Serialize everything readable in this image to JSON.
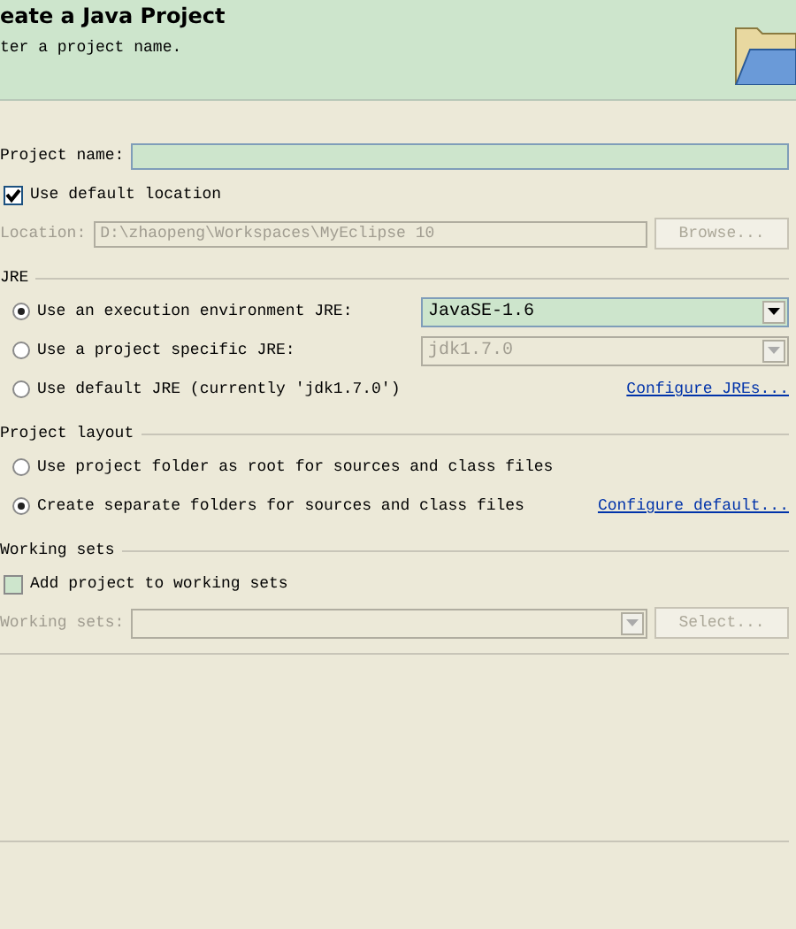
{
  "header": {
    "title": "eate a Java Project",
    "message": "ter a project name."
  },
  "project_name": {
    "label": "Project name:"
  },
  "default_location": {
    "label": "Use default location",
    "checked": true
  },
  "location": {
    "label": "Location:",
    "value": "D:\\zhaopeng\\Workspaces\\MyEclipse 10",
    "disabled": true,
    "button": "Browse..."
  },
  "jre": {
    "title": "JRE",
    "options": [
      {
        "label": "Use an execution environment JRE:",
        "selected": true,
        "kind": "combo",
        "value": "JavaSE-1.6",
        "disabled": false
      },
      {
        "label": "Use a project specific JRE:",
        "selected": false,
        "kind": "combo",
        "value": "jdk1.7.0",
        "disabled": true
      },
      {
        "label": "Use default JRE (currently 'jdk1.7.0')",
        "selected": false,
        "kind": "link",
        "link": "Configure JREs..."
      }
    ]
  },
  "project_layout": {
    "title": "Project layout",
    "options": [
      {
        "label": "Use project folder as root for sources and class files",
        "selected": false
      },
      {
        "label": "Create separate folders for sources and class files",
        "selected": true,
        "link": "Configure default..."
      }
    ]
  },
  "working_sets": {
    "title": "Working sets",
    "checkbox": {
      "label": "Add project to working sets",
      "checked": false
    },
    "field_label": "Working sets:",
    "button": "Select..."
  }
}
